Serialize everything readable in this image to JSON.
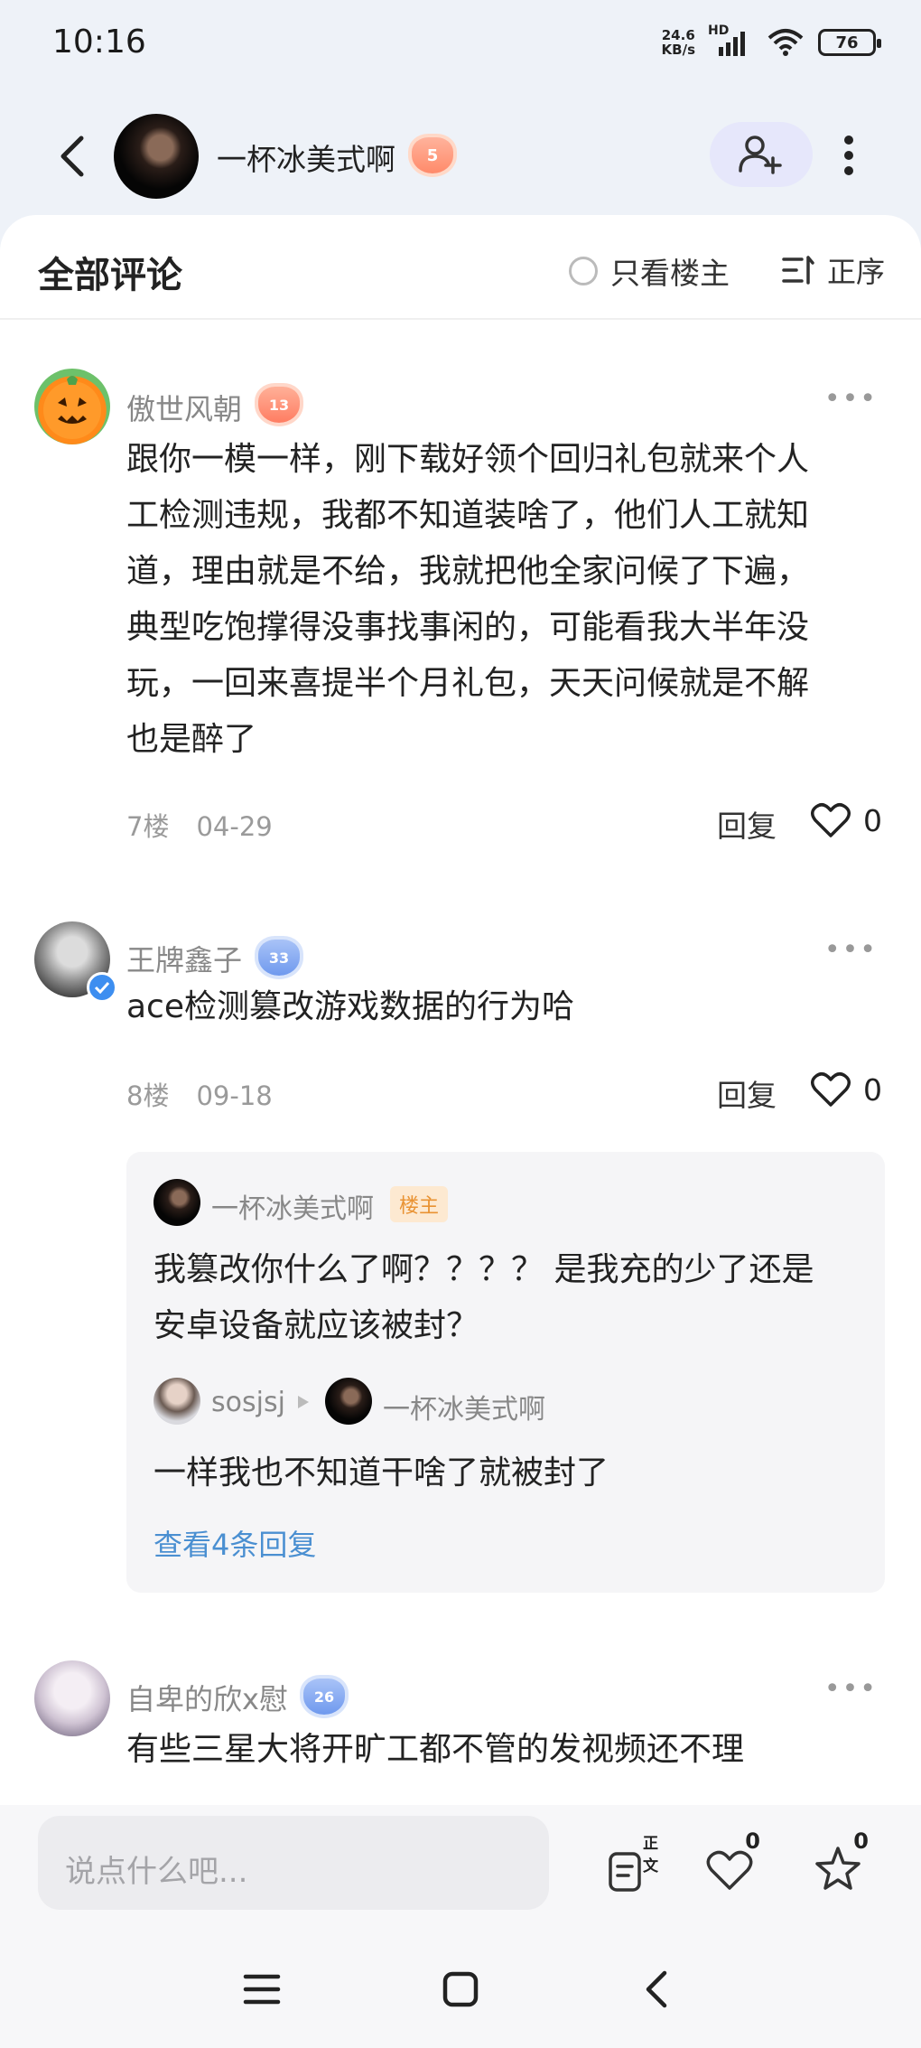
{
  "status": {
    "time": "10:16",
    "netspeed_value": "24.6",
    "netspeed_unit": "KB/s",
    "network": "HD",
    "battery": "76"
  },
  "header": {
    "username": "一杯冰美式啊",
    "level": "5"
  },
  "tabs": {
    "all_comments": "全部评论",
    "only_op": "只看楼主",
    "sort": "正序"
  },
  "comments": [
    {
      "username": "傲世风朝",
      "level": "13",
      "more": "•••",
      "lines": [
        "跟你一模一样，刚下载好领个回归礼包就来个人",
        "工检测违规，我都不知道装啥了，他们人工就知",
        "道，理由就是不给，我就把他全家问候了下遍，",
        "典型吃饱撑得没事找事闲的，可能看我大半年没",
        "玩，一回来喜提半个月礼包，天天问候就是不解",
        "也是醉了"
      ],
      "floor": "7楼",
      "date": "04-29",
      "reply": "回复",
      "likes": "0"
    },
    {
      "username": "王牌鑫子",
      "level": "33",
      "more": "•••",
      "lines": [
        "ace检测篡改游戏数据的行为哈"
      ],
      "floor": "8楼",
      "date": "09-18",
      "reply": "回复",
      "likes": "0",
      "replies": {
        "op_name": "一杯冰美式啊",
        "op_tag": "楼主",
        "op_lines": [
          "我篡改你什么了啊？？？？ 是我充的少了还是",
          "安卓设备就应该被封？"
        ],
        "sub_from": "sosjsj",
        "sub_to": "一杯冰美式啊",
        "sub_text": "一样我也不知道干啥了就被封了",
        "view_more": "查看4条回复"
      }
    },
    {
      "username": "自卑的欣x慰",
      "level": "26",
      "more": "•••",
      "lines": [
        "有些三星大将开旷工都不管的发视频还不理"
      ]
    }
  ],
  "bottom": {
    "placeholder": "说点什么吧...",
    "doc_label": "正文",
    "like_count": "0",
    "fav_count": "0"
  }
}
